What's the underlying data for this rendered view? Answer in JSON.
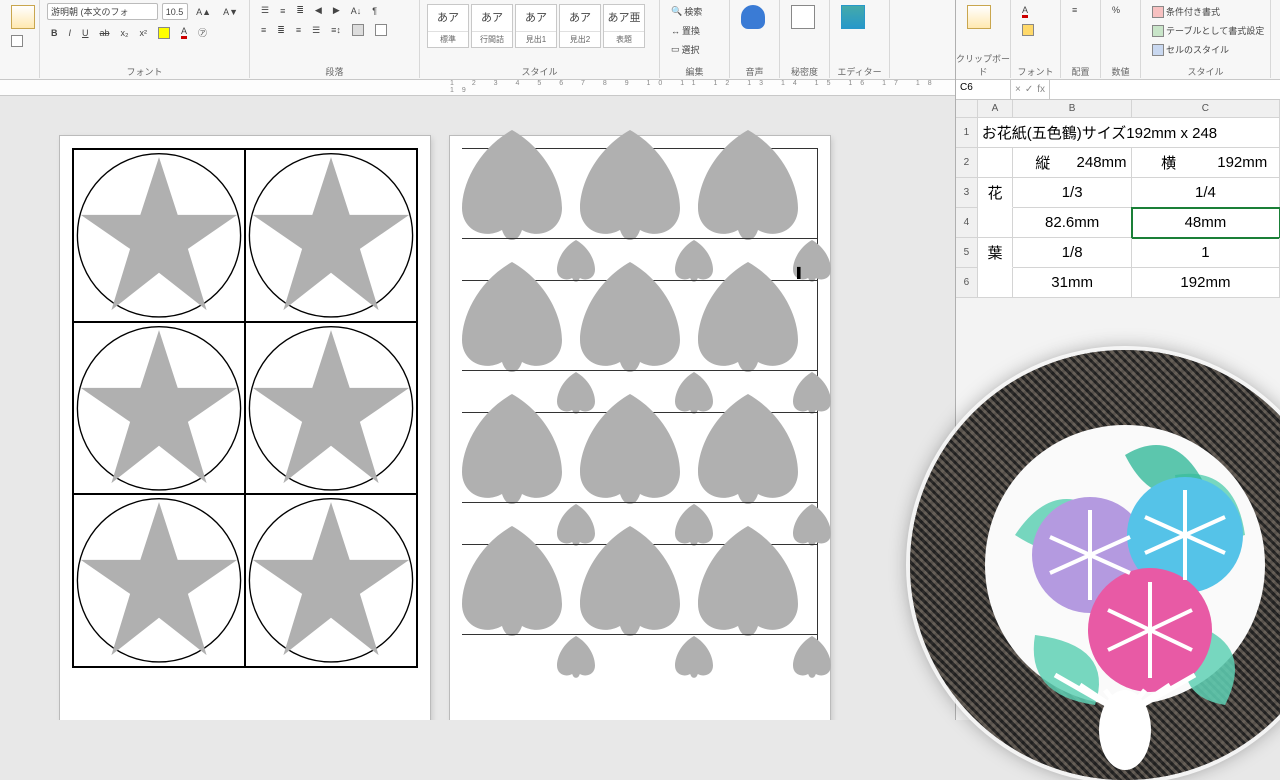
{
  "word": {
    "ribbon": {
      "clipboard": {
        "label": ""
      },
      "font": {
        "label": "フォント",
        "family": "游明朝 (本文のフォ",
        "size": "10.5"
      },
      "paragraph": {
        "label": "段落"
      },
      "styles": {
        "label": "スタイル",
        "items": [
          {
            "sample": "あア",
            "name": "標準"
          },
          {
            "sample": "あア",
            "name": "行間詰"
          },
          {
            "sample": "あア",
            "name": "見出1"
          },
          {
            "sample": "あア",
            "name": "見出2"
          },
          {
            "sample": "あア亜",
            "name": "表題"
          }
        ]
      },
      "editing": {
        "label": "編集",
        "find": "検索",
        "replace": "置換",
        "select": "選択"
      },
      "voice": {
        "label": "音声",
        "btn": "ディクテーション"
      },
      "sens": {
        "label": "秘密度"
      },
      "editor": {
        "label": "エディター"
      }
    },
    "ruler_text": "1 2 3 4 5 6 7 8 9 10 11 12 13 14 15 16 17 18 19"
  },
  "excel": {
    "ribbon": {
      "g1": "クリップボード",
      "g2": "フォント",
      "g3": "配置",
      "g4": "数値",
      "styles_label": "スタイル",
      "cond": "条件付き書式",
      "tbl": "テーブルとして書式設定",
      "cell": "セルのスタイル"
    },
    "name_box": "C6",
    "fx": "fx",
    "columns": {
      "A": "A",
      "B": "B",
      "C": "C"
    },
    "rows": {
      "r1": {
        "title": "お花紙(五色鶴)サイズ192mm x 248"
      },
      "r2": {
        "b_label": "縦",
        "b": "248mm",
        "c_label": "横",
        "c": "192mm"
      },
      "r3": {
        "a": "花",
        "b": "1/3",
        "c": "1/4"
      },
      "r4": {
        "b": "82.6mm",
        "c": "48mm"
      },
      "r5": {
        "a": "葉",
        "b": "1/8",
        "c": "1"
      },
      "r6": {
        "b": "31mm",
        "c": "192mm"
      }
    }
  },
  "fan": {
    "alt": "うちわ 朝顔デザイン"
  }
}
